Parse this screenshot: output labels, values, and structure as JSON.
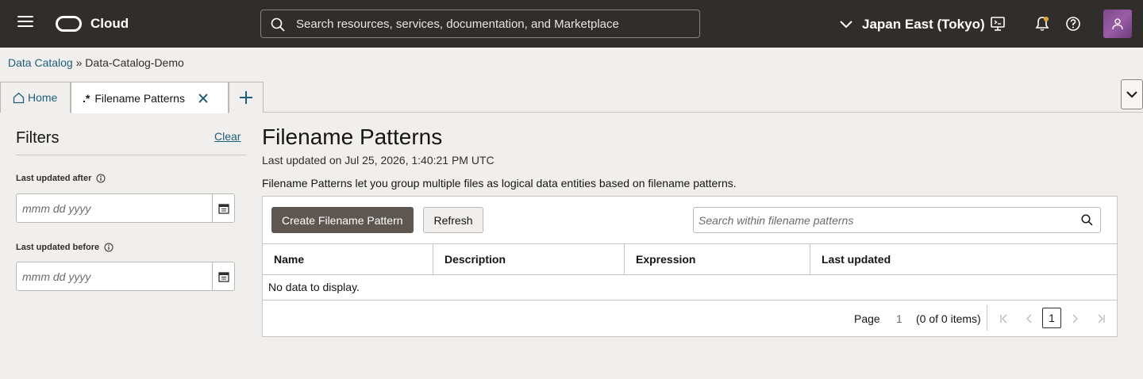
{
  "header": {
    "brand": "Cloud",
    "search_placeholder": "Search resources, services, documentation, and Marketplace",
    "region": "Japan East (Tokyo)"
  },
  "breadcrumb": {
    "root": "Data Catalog",
    "separator": "»",
    "current": "Data-Catalog-Demo"
  },
  "tabs": {
    "home": "Home",
    "active": "Filename Patterns",
    "active_icon_text": ".*"
  },
  "filters": {
    "title": "Filters",
    "clear": "Clear",
    "after_label": "Last updated after",
    "before_label": "Last updated before",
    "date_placeholder": "mmm dd yyyy"
  },
  "main": {
    "title": "Filename Patterns",
    "updated": "Last updated on Jul 25, 2026, 1:40:21 PM UTC",
    "description": "Filename Patterns let you group multiple files as logical data entities based on filename patterns."
  },
  "table": {
    "create_button": "Create Filename Pattern",
    "refresh_button": "Refresh",
    "search_placeholder": "Search within filename patterns",
    "columns": [
      "Name",
      "Description",
      "Expression",
      "Last updated"
    ],
    "empty": "No data to display."
  },
  "pager": {
    "label": "Page",
    "page": "1",
    "count": "(0 of 0 items)",
    "current": "1"
  },
  "colors": {
    "header_bg": "#312d2a",
    "link": "#1f5e7a",
    "primary_button": "#5e5651",
    "page_bg": "#f1efed"
  }
}
